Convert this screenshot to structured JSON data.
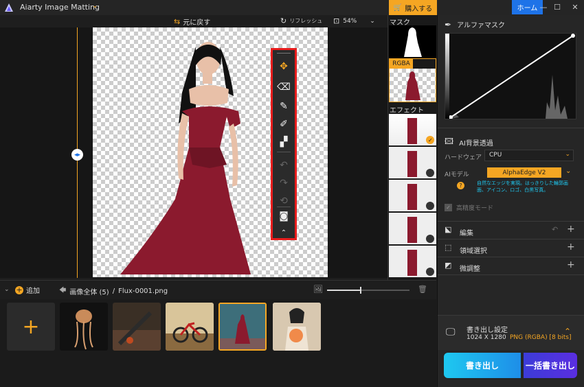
{
  "app": {
    "title": "Aiarty Image Matting",
    "title_dropdown": "⌄"
  },
  "window": {
    "buy_label": "購入する",
    "home_label": "ホーム",
    "min": "—",
    "max": "☐",
    "close": "✕"
  },
  "canvas_bar": {
    "undo_label": "元に戻す",
    "refresh_label": "リフレッシュ",
    "zoom": "54%",
    "zoom_dropdown": "⌄"
  },
  "panel": {
    "mask_label": "マスク",
    "rgba_label": "RGBA",
    "effect_label": "エフェクト"
  },
  "bottom": {
    "add_label": "追加",
    "breadcrumb_all": "画像全体 (5)",
    "breadcrumb_sep": "/",
    "breadcrumb_file": "Flux-0001.png"
  },
  "thumbnails": [
    {
      "name": "jellyfish"
    },
    {
      "name": "forest-floor"
    },
    {
      "name": "bicycle"
    },
    {
      "name": "woman-forest",
      "selected": true
    },
    {
      "name": "woman-flowers"
    }
  ],
  "right": {
    "alpha_title": "アルファマスク",
    "ai_bg_title": "AI背景透過",
    "hardware_label": "ハードウェア",
    "hardware_value": "CPU",
    "model_label": "AIモデル",
    "model_value": "AlphaEdge V2",
    "model_desc": "自然なエッジを実現。はっきりした輪郭画面、アイコン、ロゴ、白黒写真。",
    "hq_label": "高精度モード",
    "edit_label": "編集",
    "region_label": "領域選択",
    "finetune_label": "微調整",
    "export_title": "書き出し設定",
    "export_size": "1024 X 1280",
    "export_format": "PNG (RGBA) [8 bits]",
    "export_btn": "書き出し",
    "batch_btn": "一括書き出し"
  },
  "colors": {
    "accent": "#f5a623",
    "blue": "#1e73e8",
    "cyan": "#1ec8f0",
    "dress": "#8b1a2e",
    "highlight": "#e81c1c"
  }
}
